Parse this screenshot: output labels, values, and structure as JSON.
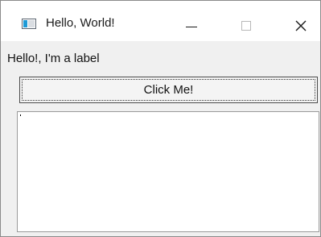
{
  "window": {
    "title": "Hello, World!",
    "controls": {
      "minimize": "minimize-icon",
      "maximize": "maximize-icon",
      "close": "close-icon"
    }
  },
  "content": {
    "label_text": "Hello!, I'm a label",
    "button_label": "Click Me!",
    "textarea_value": ""
  },
  "colors": {
    "window_background": "#f0f0f0",
    "titlebar_background": "#ffffff",
    "icon_accent": "#1e9ad6"
  }
}
